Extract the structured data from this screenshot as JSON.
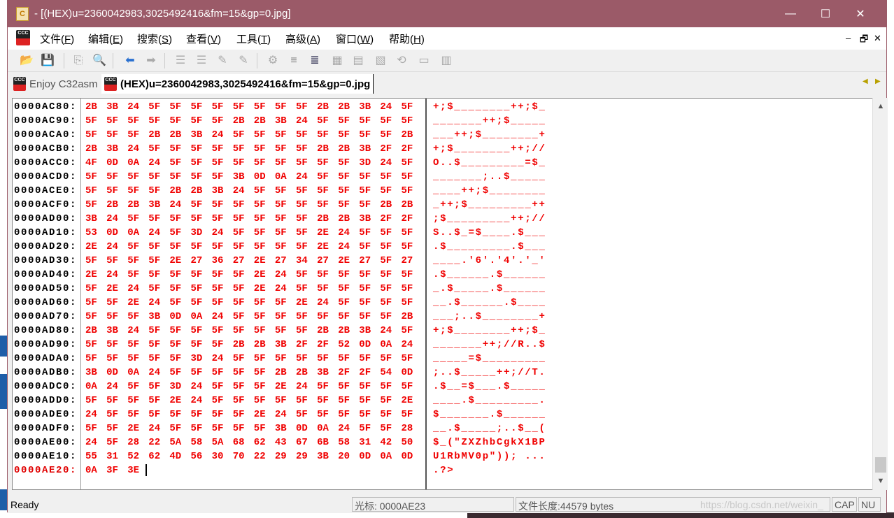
{
  "window": {
    "title": "- [(HEX)u=2360042983,3025492416&fm=15&gp=0.jpg]",
    "minimize_icon": "minimize-icon",
    "maximize_icon": "maximize-icon",
    "close_icon": "close-icon"
  },
  "menu": {
    "items": [
      {
        "label": "文件(",
        "key": "F",
        "end": ")"
      },
      {
        "label": "编辑(",
        "key": "E",
        "end": ")"
      },
      {
        "label": "搜索(",
        "key": "S",
        "end": ")"
      },
      {
        "label": "查看(",
        "key": "V",
        "end": ")"
      },
      {
        "label": "工具(",
        "key": "T",
        "end": ")"
      },
      {
        "label": "高级(",
        "key": "A",
        "end": ")"
      },
      {
        "label": "窗口(",
        "key": "W",
        "end": ")"
      },
      {
        "label": "帮助(",
        "key": "H",
        "end": ")"
      }
    ],
    "mdi": {
      "minimize": "–",
      "restore": "🗗",
      "close": "✕"
    }
  },
  "toolbar": {
    "icons": [
      "open-folder-icon",
      "save-icon",
      "copy-icon",
      "find-icon",
      "back-arrow-icon",
      "forward-arrow-icon",
      "indent-left-icon",
      "indent-right-icon",
      "bookmark-icon",
      "bookmark-next-icon",
      "gear-icon",
      "list-icon",
      "list-indent-icon",
      "hex-table-icon",
      "ruler-icon",
      "hex-percent-icon",
      "convert-icon",
      "window-icon",
      "columns-icon"
    ]
  },
  "tabs": [
    {
      "label": "Enjoy C32asm",
      "active": false
    },
    {
      "label": "(HEX)u=2360042983,3025492416&fm=15&gp=0.jpg",
      "active": true
    }
  ],
  "tab_arrows": {
    "left": "◀",
    "right": "▶"
  },
  "hex": {
    "colors": {
      "bytes": "#f00000",
      "address": "#000000",
      "current_address": "#e00000"
    },
    "rows": [
      {
        "addr": "0000AC80:",
        "bytes": "2B 3B 24 5F 5F 5F 5F 5F 5F 5F 5F 2B 2B 3B 24 5F",
        "ascii": "+;$________++;$_"
      },
      {
        "addr": "0000AC90:",
        "bytes": "5F 5F 5F 5F 5F 5F 5F 2B 2B 3B 24 5F 5F 5F 5F 5F",
        "ascii": "_______++;$_____"
      },
      {
        "addr": "0000ACA0:",
        "bytes": "5F 5F 5F 2B 2B 3B 24 5F 5F 5F 5F 5F 5F 5F 5F 2B",
        "ascii": "___++;$________+"
      },
      {
        "addr": "0000ACB0:",
        "bytes": "2B 3B 24 5F 5F 5F 5F 5F 5F 5F 5F 2B 2B 3B 2F 2F",
        "ascii": "+;$________++;//"
      },
      {
        "addr": "0000ACC0:",
        "bytes": "4F 0D 0A 24 5F 5F 5F 5F 5F 5F 5F 5F 5F 3D 24 5F",
        "ascii": "O..$_________=$_"
      },
      {
        "addr": "0000ACD0:",
        "bytes": "5F 5F 5F 5F 5F 5F 5F 3B 0D 0A 24 5F 5F 5F 5F 5F",
        "ascii": "_______;..$_____"
      },
      {
        "addr": "0000ACE0:",
        "bytes": "5F 5F 5F 5F 2B 2B 3B 24 5F 5F 5F 5F 5F 5F 5F 5F",
        "ascii": "____++;$________"
      },
      {
        "addr": "0000ACF0:",
        "bytes": "5F 2B 2B 3B 24 5F 5F 5F 5F 5F 5F 5F 5F 5F 2B 2B",
        "ascii": "_++;$_________++"
      },
      {
        "addr": "0000AD00:",
        "bytes": "3B 24 5F 5F 5F 5F 5F 5F 5F 5F 5F 2B 2B 3B 2F 2F",
        "ascii": ";$_________++;//"
      },
      {
        "addr": "0000AD10:",
        "bytes": "53 0D 0A 24 5F 3D 24 5F 5F 5F 5F 2E 24 5F 5F 5F",
        "ascii": "S..$_=$____.$___"
      },
      {
        "addr": "0000AD20:",
        "bytes": "2E 24 5F 5F 5F 5F 5F 5F 5F 5F 5F 2E 24 5F 5F 5F",
        "ascii": ".$_________.$___"
      },
      {
        "addr": "0000AD30:",
        "bytes": "5F 5F 5F 5F 2E 27 36 27 2E 27 34 27 2E 27 5F 27",
        "ascii": "____.'6'.'4'.'_'"
      },
      {
        "addr": "0000AD40:",
        "bytes": "2E 24 5F 5F 5F 5F 5F 5F 2E 24 5F 5F 5F 5F 5F 5F",
        "ascii": ".$______.$______"
      },
      {
        "addr": "0000AD50:",
        "bytes": "5F 2E 24 5F 5F 5F 5F 5F 2E 24 5F 5F 5F 5F 5F 5F",
        "ascii": "_.$_____.$______"
      },
      {
        "addr": "0000AD60:",
        "bytes": "5F 5F 2E 24 5F 5F 5F 5F 5F 5F 2E 24 5F 5F 5F 5F",
        "ascii": "__.$______.$____"
      },
      {
        "addr": "0000AD70:",
        "bytes": "5F 5F 5F 3B 0D 0A 24 5F 5F 5F 5F 5F 5F 5F 5F 2B",
        "ascii": "___;..$________+"
      },
      {
        "addr": "0000AD80:",
        "bytes": "2B 3B 24 5F 5F 5F 5F 5F 5F 5F 5F 2B 2B 3B 24 5F",
        "ascii": "+;$________++;$_"
      },
      {
        "addr": "0000AD90:",
        "bytes": "5F 5F 5F 5F 5F 5F 5F 2B 2B 3B 2F 2F 52 0D 0A 24",
        "ascii": "_______++;//R..$"
      },
      {
        "addr": "0000ADA0:",
        "bytes": "5F 5F 5F 5F 5F 3D 24 5F 5F 5F 5F 5F 5F 5F 5F 5F",
        "ascii": "_____=$_________"
      },
      {
        "addr": "0000ADB0:",
        "bytes": "3B 0D 0A 24 5F 5F 5F 5F 5F 2B 2B 3B 2F 2F 54 0D",
        "ascii": ";..$_____++;//T."
      },
      {
        "addr": "0000ADC0:",
        "bytes": "0A 24 5F 5F 3D 24 5F 5F 5F 2E 24 5F 5F 5F 5F 5F",
        "ascii": ".$__=$___.$_____"
      },
      {
        "addr": "0000ADD0:",
        "bytes": "5F 5F 5F 5F 2E 24 5F 5F 5F 5F 5F 5F 5F 5F 5F 2E",
        "ascii": "____.$_________."
      },
      {
        "addr": "0000ADE0:",
        "bytes": "24 5F 5F 5F 5F 5F 5F 5F 2E 24 5F 5F 5F 5F 5F 5F",
        "ascii": "$_______.$______"
      },
      {
        "addr": "0000ADF0:",
        "bytes": "5F 5F 2E 24 5F 5F 5F 5F 5F 3B 0D 0A 24 5F 5F 28",
        "ascii": "__.$_____;..$__("
      },
      {
        "addr": "0000AE00:",
        "bytes": "24 5F 28 22 5A 58 5A 68 62 43 67 6B 58 31 42 50",
        "ascii": "$_(\"ZXZhbCgkX1BP"
      },
      {
        "addr": "0000AE10:",
        "bytes": "55 31 52 62 4D 56 30 70 22 29 29 3B 20 0D 0A 0D",
        "ascii": "U1RbMV0p\")); ..."
      },
      {
        "addr": "0000AE20:",
        "bytes": "0A 3F 3E",
        "ascii": ".?>",
        "current": true
      }
    ]
  },
  "scrollbar": {
    "up": "▲",
    "down": "▼"
  },
  "status": {
    "ready": "Ready",
    "cursor": "光标: 0000AE23",
    "file_length": "文件长度:44579 bytes",
    "watermark": "https://blog.csdn.net/weixin_",
    "cap": "CAP",
    "num": "NU"
  }
}
